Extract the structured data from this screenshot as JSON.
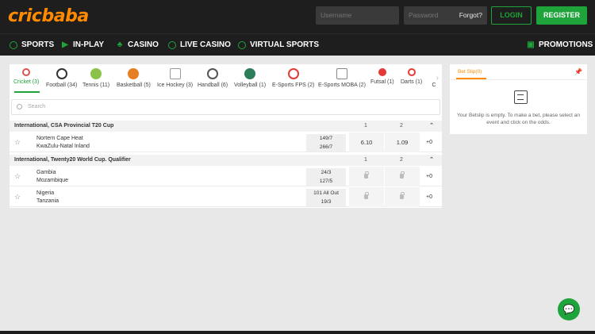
{
  "header": {
    "logo_part1": "cric",
    "logo_part2": "baba",
    "username_placeholder": "Username",
    "password_placeholder": "Password",
    "forgot_label": "Forgot?",
    "login_label": "LOGIN",
    "register_label": "REGISTER"
  },
  "nav": {
    "sports": "SPORTS",
    "inplay": "IN-PLAY",
    "casino": "CASINO",
    "live_casino": "LIVE CASINO",
    "virtual_sports": "VIRTUAL SPORTS",
    "promotions": "PROMOTIONS"
  },
  "sports": [
    {
      "label": "Cricket (3)",
      "icon": "cricket-icon",
      "color": "#d9534f"
    },
    {
      "label": "Football (34)",
      "icon": "football-icon",
      "color": "#333333"
    },
    {
      "label": "Tennis (11)",
      "icon": "tennis-icon",
      "color": "#8bc34a"
    },
    {
      "label": "Basketball (5)",
      "icon": "basketball-icon",
      "color": "#e67e22"
    },
    {
      "label": "Ice Hockey (3)",
      "icon": "ice-hockey-icon",
      "color": "#999999"
    },
    {
      "label": "Handball (6)",
      "icon": "handball-icon",
      "color": "#555555"
    },
    {
      "label": "Volleyball (1)",
      "icon": "volleyball-icon",
      "color": "#2e7d5a"
    },
    {
      "label": "E-Sports FPS (2)",
      "icon": "esports-fps-icon",
      "color": "#e53935"
    },
    {
      "label": "E-Sports MOBA (2)",
      "icon": "esports-moba-icon",
      "color": "#888888"
    },
    {
      "label": "Futsal (1)",
      "icon": "futsal-icon",
      "color": "#e53935"
    },
    {
      "label": "Darts (1)",
      "icon": "darts-icon",
      "color": "#e53935"
    },
    {
      "label": "C",
      "icon": "sport-icon",
      "color": "#999999"
    }
  ],
  "search_placeholder": "Search",
  "col_1": "1",
  "col_2": "2",
  "groups": [
    {
      "title": "International, CSA Provincial T20 Cup",
      "matches": [
        {
          "home": "Nortern Cape Heat",
          "away": "KwaZulu-Natal Inland",
          "home_score": "149/7",
          "away_score": "266/7",
          "odd1": "6.10",
          "odd2": "1.09",
          "more": "+0"
        }
      ]
    },
    {
      "title": "International, Twenty20 World Cup. Qualifier",
      "matches": [
        {
          "home": "Gambia",
          "away": "Mozambique",
          "home_score": "24/3",
          "away_score": "127/5",
          "more": "+0"
        },
        {
          "home": "Nigeria",
          "away": "Tanzania",
          "home_score": "101 All Out",
          "away_score": "19/3",
          "more": "+0"
        }
      ]
    }
  ],
  "betslip": {
    "title": "Bet Slip(0)",
    "empty_text": "Your Betslip is empty. To make a bet, please select an event and click on the odds."
  },
  "colors": {
    "accent": "#1fa33b",
    "brand": "#ff8a00",
    "header_bg": "#1e1e1e"
  }
}
